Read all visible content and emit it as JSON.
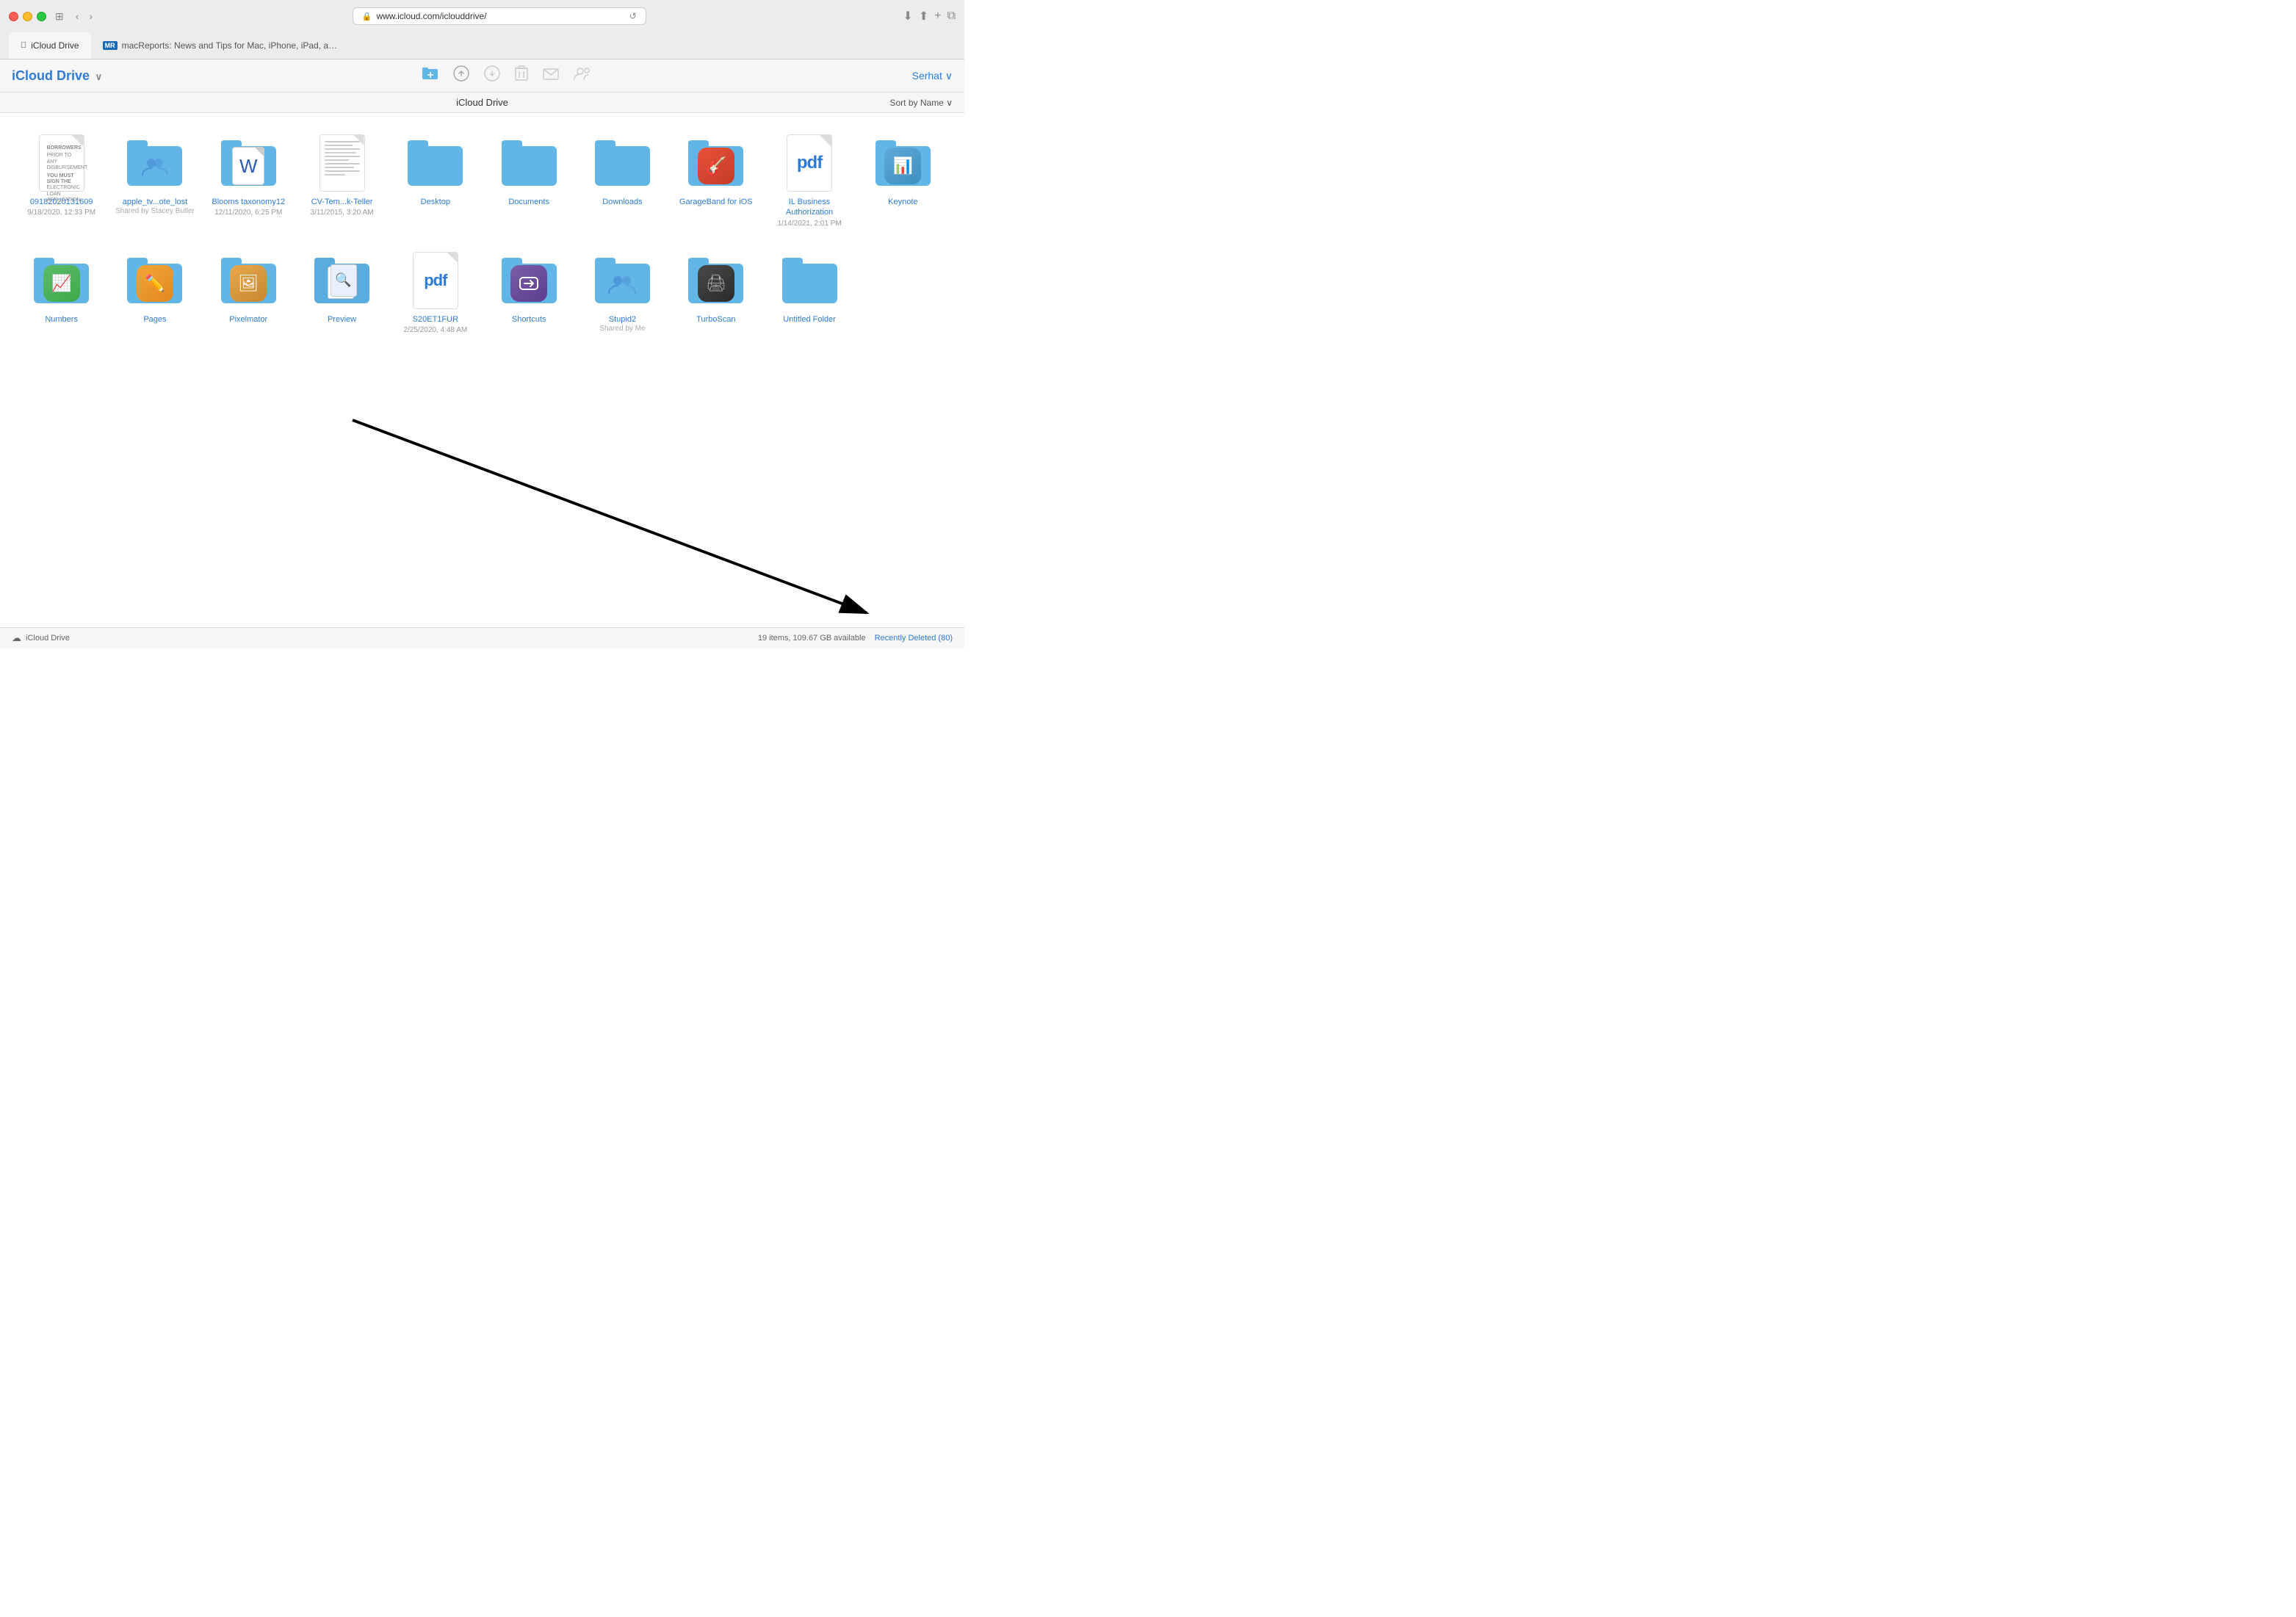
{
  "browser": {
    "url": "www.icloud.com/iclouddrive/",
    "tabs": [
      {
        "label": "iCloud Drive",
        "icon": "☁",
        "active": true
      },
      {
        "label": "macReports: News and Tips for Mac, iPhone, iPad, and all things Apple",
        "icon": "MR",
        "active": false
      }
    ],
    "reload_icon": "↺"
  },
  "toolbar": {
    "app_title_plain": "iCloud",
    "app_title_colored": "Drive",
    "chevron": "∨",
    "user_label": "Serhat",
    "user_chevron": "∨",
    "sort_label": "Sort by Name",
    "sort_chevron": "∨",
    "drive_title": "iCloud Drive"
  },
  "toolbar_icons": {
    "new_folder": "⊡",
    "upload": "⬆",
    "download": "⬇",
    "delete": "🗑",
    "share": "✉",
    "people": "👥"
  },
  "files": [
    {
      "name": "09182020131609",
      "type": "document-lines",
      "date": "9/18/2020, 12:33 PM",
      "shared": ""
    },
    {
      "name": "apple_tv...ote_lost",
      "type": "folder-shared",
      "date": "",
      "shared": "Shared by Stacey Butler"
    },
    {
      "name": "Blooms taxonomy12",
      "type": "folder-word",
      "date": "12/11/2020, 6:25 PM",
      "shared": ""
    },
    {
      "name": "CV-Tem...k-Teller",
      "type": "document-lines",
      "date": "3/11/2015, 3:20 AM",
      "shared": ""
    },
    {
      "name": "Desktop",
      "type": "folder",
      "date": "",
      "shared": ""
    },
    {
      "name": "Documents",
      "type": "folder",
      "date": "",
      "shared": ""
    },
    {
      "name": "Downloads",
      "type": "folder",
      "date": "",
      "shared": ""
    },
    {
      "name": "GarageBand for iOS",
      "type": "folder-garageband",
      "date": "",
      "shared": ""
    },
    {
      "name": "IL Business Authorization",
      "type": "pdf",
      "date": "1/14/2021, 2:01 PM",
      "shared": ""
    },
    {
      "name": "Keynote",
      "type": "folder-keynote",
      "date": "",
      "shared": ""
    },
    {
      "name": "Numbers",
      "type": "folder-numbers",
      "date": "",
      "shared": ""
    },
    {
      "name": "Pages",
      "type": "folder-pages",
      "date": "",
      "shared": ""
    },
    {
      "name": "Pixelmator",
      "type": "folder-pixelmator",
      "date": "",
      "shared": ""
    },
    {
      "name": "Preview",
      "type": "folder-preview",
      "date": "",
      "shared": ""
    },
    {
      "name": "S20ET1FUR",
      "type": "pdf-blue",
      "date": "2/25/2020, 4:48 AM",
      "shared": ""
    },
    {
      "name": "Shortcuts",
      "type": "folder-shortcuts",
      "date": "",
      "shared": ""
    },
    {
      "name": "Stupid2",
      "type": "folder-shared-people",
      "date": "",
      "shared": "Shared by Me"
    },
    {
      "name": "TurboScan",
      "type": "folder-turboscan",
      "date": "",
      "shared": ""
    },
    {
      "name": "Untitled Folder",
      "type": "folder",
      "date": "",
      "shared": ""
    }
  ],
  "status": {
    "left_icon": "☁",
    "left_label": "iCloud Drive",
    "items_count": "19 items, 109.67 GB available",
    "recently_deleted": "Recently Deleted (80)"
  }
}
